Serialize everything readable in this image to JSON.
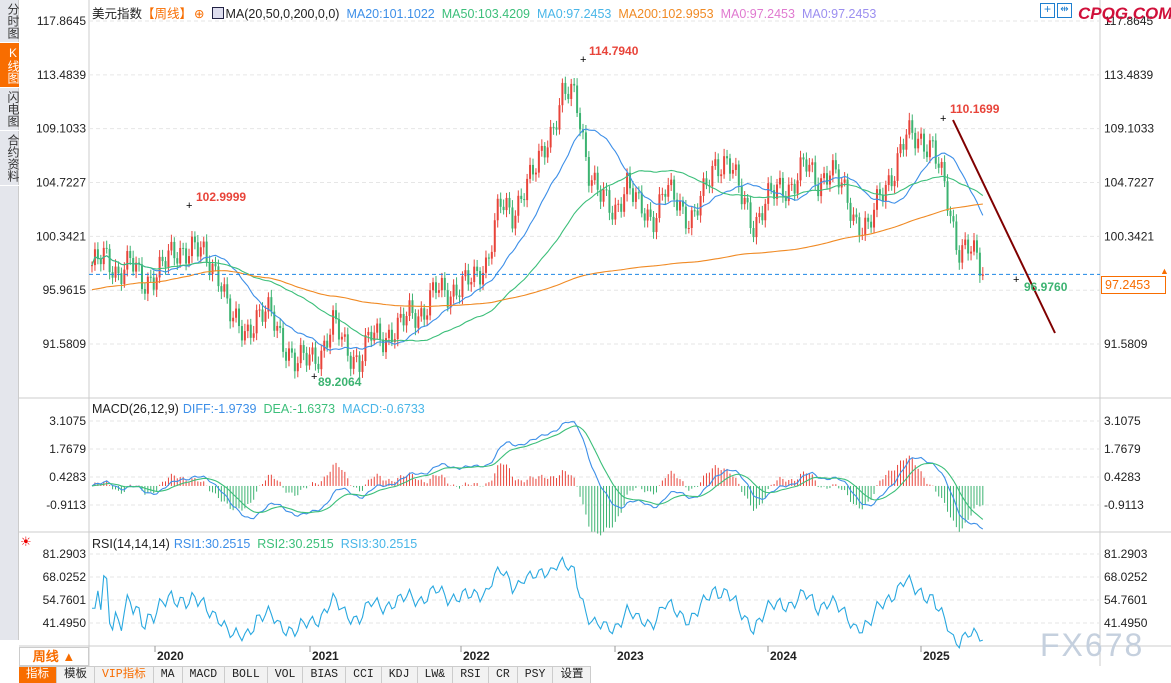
{
  "sidebar": {
    "items": [
      {
        "label": "分时图"
      },
      {
        "label": "K线图",
        "active": true
      },
      {
        "label": "闪电图"
      },
      {
        "label": "合约资料"
      }
    ]
  },
  "header": {
    "title": "美元指数",
    "period_tag": "【周线】",
    "ma_label": "MA(20,50,0,200,0,0)",
    "ma_values": [
      {
        "text": "MA20:101.1022",
        "color": "#3d8fe8"
      },
      {
        "text": "MA50:103.4209",
        "color": "#3cbf7a"
      },
      {
        "text": "MA0:97.2453",
        "color": "#49b6e8"
      },
      {
        "text": "MA200:102.9953",
        "color": "#f08a24"
      },
      {
        "text": "MA0:97.2453",
        "color": "#e07ad0"
      },
      {
        "text": "MA0:97.2453",
        "color": "#9b8ef0"
      }
    ]
  },
  "logo": "CPQG.COM",
  "watermark": "FX678",
  "macd": {
    "label": "MACD(26,12,9)",
    "values": [
      {
        "text": "DIFF:-1.9739",
        "color": "#3d8fe8"
      },
      {
        "text": "DEA:-1.6373",
        "color": "#3cbf7a"
      },
      {
        "text": "MACD:-0.6733",
        "color": "#49b6e8"
      }
    ]
  },
  "rsi": {
    "label": "RSI(14,14,14)",
    "values": [
      {
        "text": "RSI1:30.2515",
        "color": "#3d8fe8"
      },
      {
        "text": "RSI2:30.2515",
        "color": "#3cbf7a"
      },
      {
        "text": "RSI3:30.2515",
        "color": "#49b6e8"
      }
    ]
  },
  "period_button": "周线 ▲",
  "toolbar": [
    {
      "label": "指标",
      "active": true
    },
    {
      "label": "模板"
    },
    {
      "label": "VIP指标",
      "vip": true
    },
    {
      "label": "MA"
    },
    {
      "label": "MACD"
    },
    {
      "label": "BOLL"
    },
    {
      "label": "VOL"
    },
    {
      "label": "BIAS"
    },
    {
      "label": "CCI"
    },
    {
      "label": "KDJ"
    },
    {
      "label": "LW&"
    },
    {
      "label": "RSI"
    },
    {
      "label": "CR"
    },
    {
      "label": "PSY"
    },
    {
      "label": "设置"
    }
  ],
  "current_price": "97.2453",
  "chart_data": {
    "type": "candlestick",
    "price_axis_ticks": [
      117.8645,
      113.4839,
      109.1033,
      104.7227,
      100.3421,
      95.9615,
      91.5809
    ],
    "macd_axis_ticks": [
      3.1075,
      1.7679,
      0.4283,
      -0.9113
    ],
    "rsi_axis_ticks": [
      81.2903,
      68.0252,
      54.7601,
      41.495
    ],
    "x_ticks": [
      "2020",
      "2021",
      "2022",
      "2023",
      "2024",
      "2025"
    ],
    "monthly_closes_from_2019_08": [
      98,
      98.6,
      97.4,
      98.3,
      96.4,
      97.4,
      98.5,
      99.2,
      99.6,
      98.3,
      97.4,
      93.4,
      92.4,
      94,
      94,
      91.9,
      89.9,
      90.5,
      90.9,
      93.2,
      91.3,
      90,
      92.4,
      92.2,
      92.7,
      94.2,
      94.1,
      96,
      95.7,
      96.5,
      96.7,
      98.3,
      103,
      101.8,
      104.7,
      105.9,
      108.7,
      112.1,
      111.5,
      105.9,
      103.5,
      102.1,
      104.9,
      102.5,
      101.7,
      104.3,
      102.9,
      101.8,
      103.6,
      106.2,
      106.7,
      103.5,
      101.3,
      103.3,
      104.2,
      104.5,
      106.2,
      104.7,
      105.9,
      104.1,
      101.7,
      100.8,
      104,
      105.7,
      108.5,
      108.4,
      107.6,
      104.2,
      99.5,
      99.3,
      97.3
    ],
    "annotations": [
      {
        "text": "102.9999",
        "type": "high",
        "color": "#e8443a"
      },
      {
        "text": "89.2064",
        "type": "low",
        "color": "#3cb371"
      },
      {
        "text": "114.7940",
        "type": "high",
        "color": "#e8443a"
      },
      {
        "text": "110.1699",
        "type": "high",
        "color": "#e8443a"
      },
      {
        "text": "96.9760",
        "type": "low",
        "color": "#3cb371"
      }
    ],
    "colors": {
      "up": "#e8443a",
      "down": "#3cb371",
      "ma20": "#3d8fe8",
      "ma50": "#3cbf7a",
      "ma200": "#f08a24",
      "trendline": "#800000",
      "price_line": "#1e88e5"
    }
  }
}
